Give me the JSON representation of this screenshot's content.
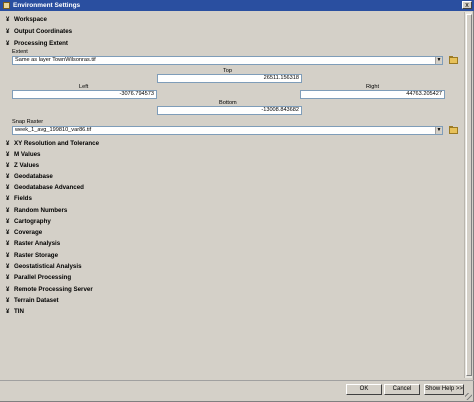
{
  "window": {
    "title": "Environment Settings",
    "close_glyph": "x"
  },
  "sections": [
    {
      "label": "Workspace",
      "expanded": false
    },
    {
      "label": "Output Coordinates",
      "expanded": false
    },
    {
      "label": "Processing Extent",
      "expanded": true
    },
    {
      "label": "XY Resolution and Tolerance",
      "expanded": false
    },
    {
      "label": "M Values",
      "expanded": false
    },
    {
      "label": "Z Values",
      "expanded": false
    },
    {
      "label": "Geodatabase",
      "expanded": false
    },
    {
      "label": "Geodatabase Advanced",
      "expanded": false
    },
    {
      "label": "Fields",
      "expanded": false
    },
    {
      "label": "Random Numbers",
      "expanded": false
    },
    {
      "label": "Cartography",
      "expanded": false
    },
    {
      "label": "Coverage",
      "expanded": false
    },
    {
      "label": "Raster Analysis",
      "expanded": false
    },
    {
      "label": "Raster Storage",
      "expanded": false
    },
    {
      "label": "Geostatistical Analysis",
      "expanded": false
    },
    {
      "label": "Parallel Processing",
      "expanded": false
    },
    {
      "label": "Remote Processing Server",
      "expanded": false
    },
    {
      "label": "Terrain Dataset",
      "expanded": false
    },
    {
      "label": "TIN",
      "expanded": false
    }
  ],
  "icons": {
    "collapsed": "chevron-double-down-icon",
    "expanded": "chevron-double-up-icon",
    "browse": "folder-icon",
    "dropdown": "dropdown-arrow-icon"
  },
  "glyphs": {
    "collapsed": "¥",
    "expanded": "¥",
    "dropdown": "▼"
  },
  "extent": {
    "label": "Extent",
    "value": "Same as layer TownWilsonras.tif",
    "top_label": "Top",
    "top_value": "26511.156318",
    "left_label": "Left",
    "left_value": "-3076.794573",
    "right_label": "Right",
    "right_value": "44763.205427",
    "bottom_label": "Bottom",
    "bottom_value": "-13008.843682"
  },
  "snap_raster": {
    "label": "Snap Raster",
    "value": "week_1_avg_199810_var86.tif"
  },
  "buttons": {
    "ok": "OK",
    "cancel": "Cancel",
    "help": "Show Help >>"
  }
}
